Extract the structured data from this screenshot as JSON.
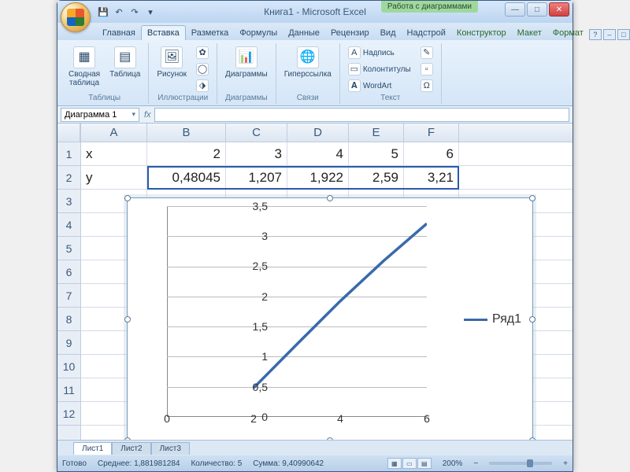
{
  "window": {
    "title": "Книга1 - Microsoft Excel",
    "chart_tools_label": "Работа с диаграммами"
  },
  "tabs": {
    "home": "Главная",
    "insert": "Вставка",
    "layout": "Разметка",
    "formulas": "Формулы",
    "data": "Данные",
    "review": "Рецензир",
    "view": "Вид",
    "addins": "Надстрой",
    "design": "Конструктор",
    "chart_layout": "Макет",
    "format": "Формат"
  },
  "ribbon": {
    "pivot": "Сводная\nтаблица",
    "table": "Таблица",
    "tables_group": "Таблицы",
    "picture": "Рисунок",
    "illustrations_group": "Иллюстрации",
    "charts": "Диаграммы",
    "charts_group": "Диаграммы",
    "hyperlink": "Гиперссылка",
    "links_group": "Связи",
    "textbox": "Надпись",
    "headerfooter": "Колонтитулы",
    "wordart": "WordArt",
    "text_group": "Текст"
  },
  "formula_bar": {
    "name_box": "Диаграмма 1",
    "fx": "fx"
  },
  "columns": [
    "A",
    "B",
    "C",
    "D",
    "E",
    "F"
  ],
  "rows": [
    "1",
    "2",
    "3",
    "4",
    "5",
    "6",
    "7",
    "8",
    "9",
    "10",
    "11",
    "12"
  ],
  "grid": {
    "r1": {
      "A": "x",
      "B": "2",
      "C": "3",
      "D": "4",
      "E": "5",
      "F": "6"
    },
    "r2": {
      "A": "y",
      "B": "0,48045",
      "C": "1,207",
      "D": "1,922",
      "E": "2,59",
      "F": "3,21"
    }
  },
  "chart_data": {
    "type": "line",
    "x": [
      2,
      3,
      4,
      5,
      6
    ],
    "series": [
      {
        "name": "Ряд1",
        "values": [
          0.48045,
          1.207,
          1.922,
          2.59,
          3.21
        ]
      }
    ],
    "xlabel": "",
    "ylabel": "",
    "xlim": [
      0,
      6
    ],
    "ylim": [
      0,
      3.5
    ],
    "xticks": [
      0,
      2,
      4,
      6
    ],
    "yticks": [
      "0",
      "0,5",
      "1",
      "1,5",
      "2",
      "2,5",
      "3",
      "3,5"
    ],
    "legend": "Ряд1"
  },
  "sheet_tabs": {
    "s1": "Лист1",
    "s2": "Лист2",
    "s3": "Лист3"
  },
  "status": {
    "ready": "Готово",
    "avg_label": "Среднее:",
    "avg": "1,881981284",
    "count_label": "Количество:",
    "count": "5",
    "sum_label": "Сумма:",
    "sum": "9,40990642",
    "zoom": "200%"
  }
}
